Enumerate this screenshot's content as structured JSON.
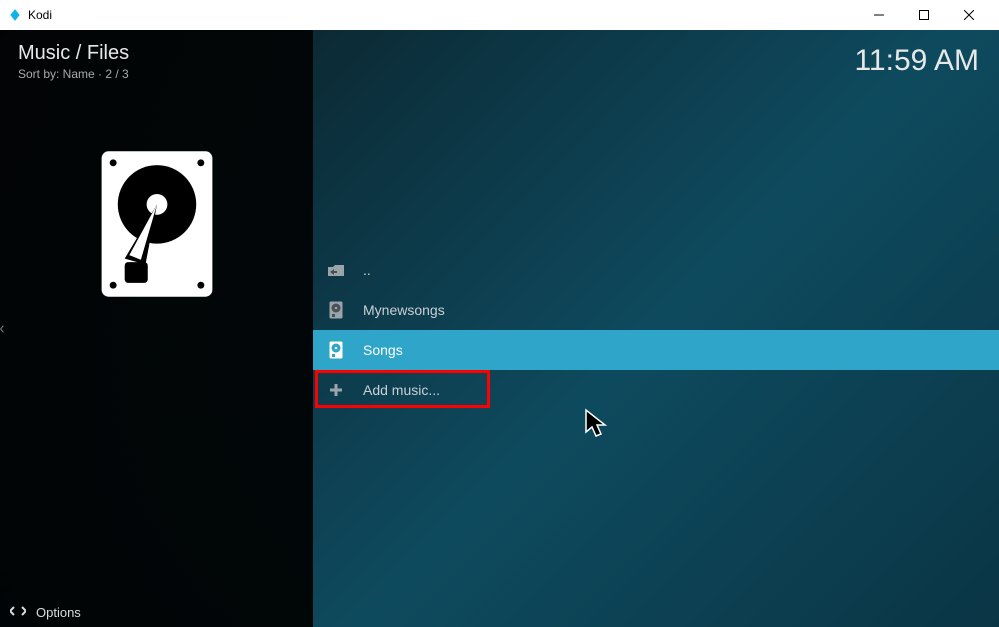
{
  "titlebar": {
    "app_name": "Kodi"
  },
  "header": {
    "breadcrumb": "Music / Files",
    "sort_label": "Sort by: Name  ·  2 / 3",
    "clock": "11:59 AM"
  },
  "list": {
    "items": [
      {
        "label": "..",
        "icon": "folder-up-icon",
        "selected": false
      },
      {
        "label": "Mynewsongs",
        "icon": "disk-icon",
        "selected": false
      },
      {
        "label": "Songs",
        "icon": "disk-icon",
        "selected": true
      },
      {
        "label": "Add music...",
        "icon": "plus-icon",
        "selected": false
      }
    ]
  },
  "footer": {
    "options_label": "Options"
  }
}
